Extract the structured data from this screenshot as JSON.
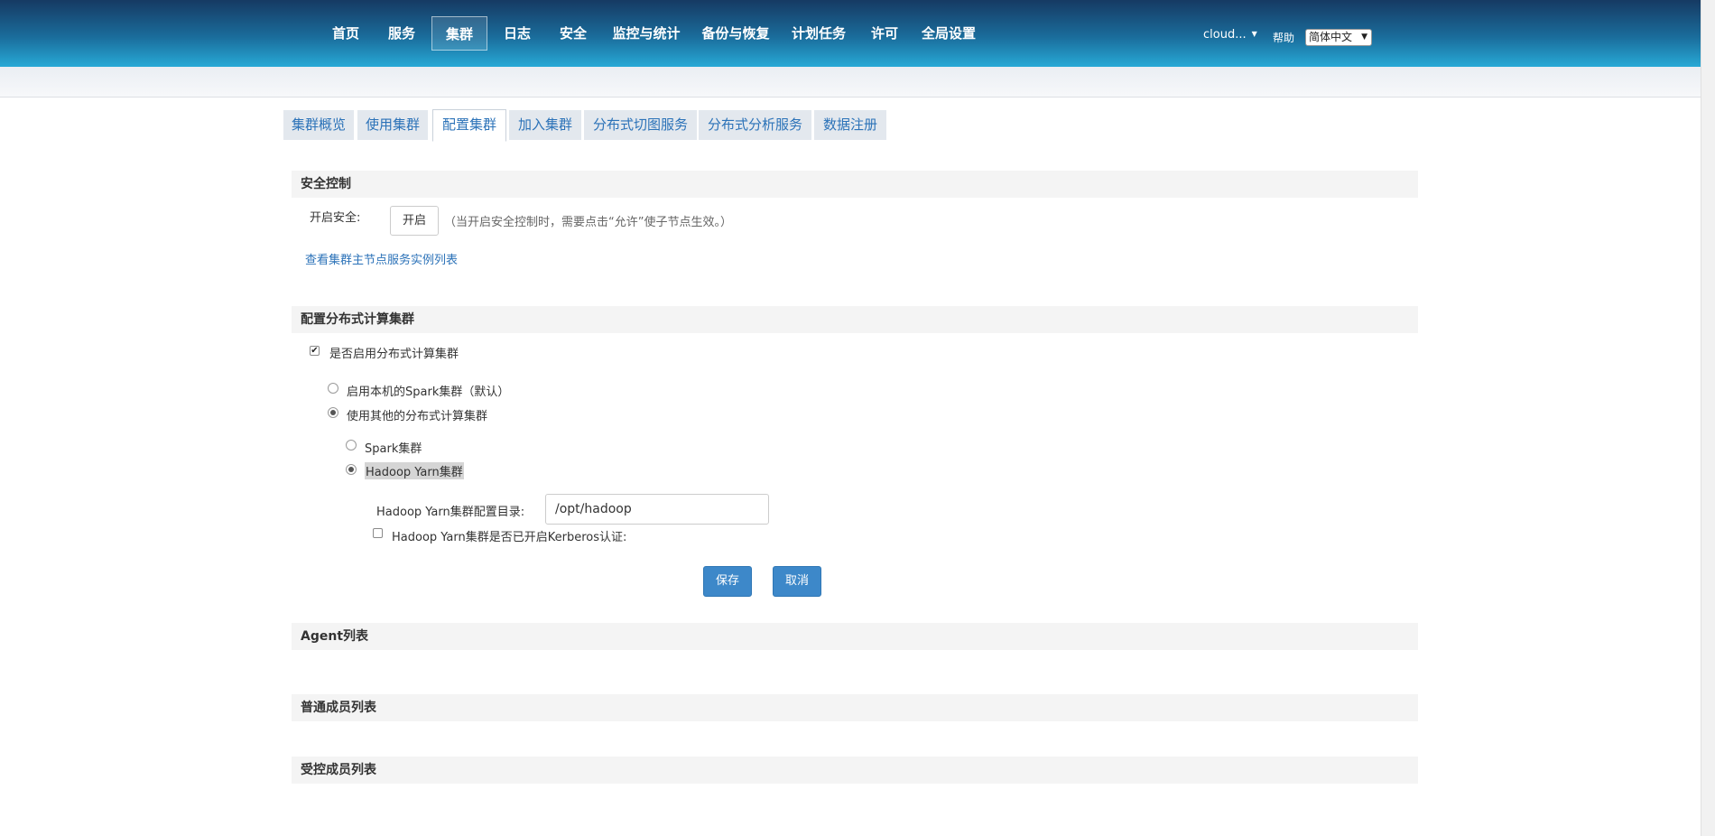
{
  "nav": {
    "items": [
      "首页",
      "服务",
      "集群",
      "日志",
      "安全",
      "监控与统计",
      "备份与恢复",
      "计划任务",
      "许可",
      "全局设置"
    ],
    "active": "集群"
  },
  "header": {
    "user": "cloud...",
    "help": "帮助",
    "language": "简体中文"
  },
  "tabs": {
    "items": [
      "集群概览",
      "使用集群",
      "配置集群",
      "加入集群",
      "分布式切图服务",
      "分布式分析服务",
      "数据注册"
    ],
    "active": "配置集群"
  },
  "security": {
    "title": "安全控制",
    "enable_label": "开启安全:",
    "enable_button": "开启",
    "hint": "（当开启安全控制时，需要点击“允许”使子节点生效。）",
    "link": "查看集群主节点服务实例列表"
  },
  "compute": {
    "title": "配置分布式计算集群",
    "enable_checkbox": "是否启用分布式计算集群",
    "enable_checked": true,
    "option_local": "启用本机的Spark集群（默认）",
    "option_other": "使用其他的分布式计算集群",
    "selected_mode": "other",
    "sub_spark": "Spark集群",
    "sub_yarn": "Hadoop Yarn集群",
    "selected_sub": "yarn",
    "yarn_dir_label": "Hadoop Yarn集群配置目录:",
    "yarn_dir_value": "/opt/hadoop",
    "kerberos_label": "Hadoop Yarn集群是否已开启Kerberos认证:",
    "kerberos_checked": false,
    "save": "保存",
    "cancel": "取消"
  },
  "lists": {
    "agent": "Agent列表",
    "normal": "普通成员列表",
    "controlled": "受控成员列表"
  }
}
